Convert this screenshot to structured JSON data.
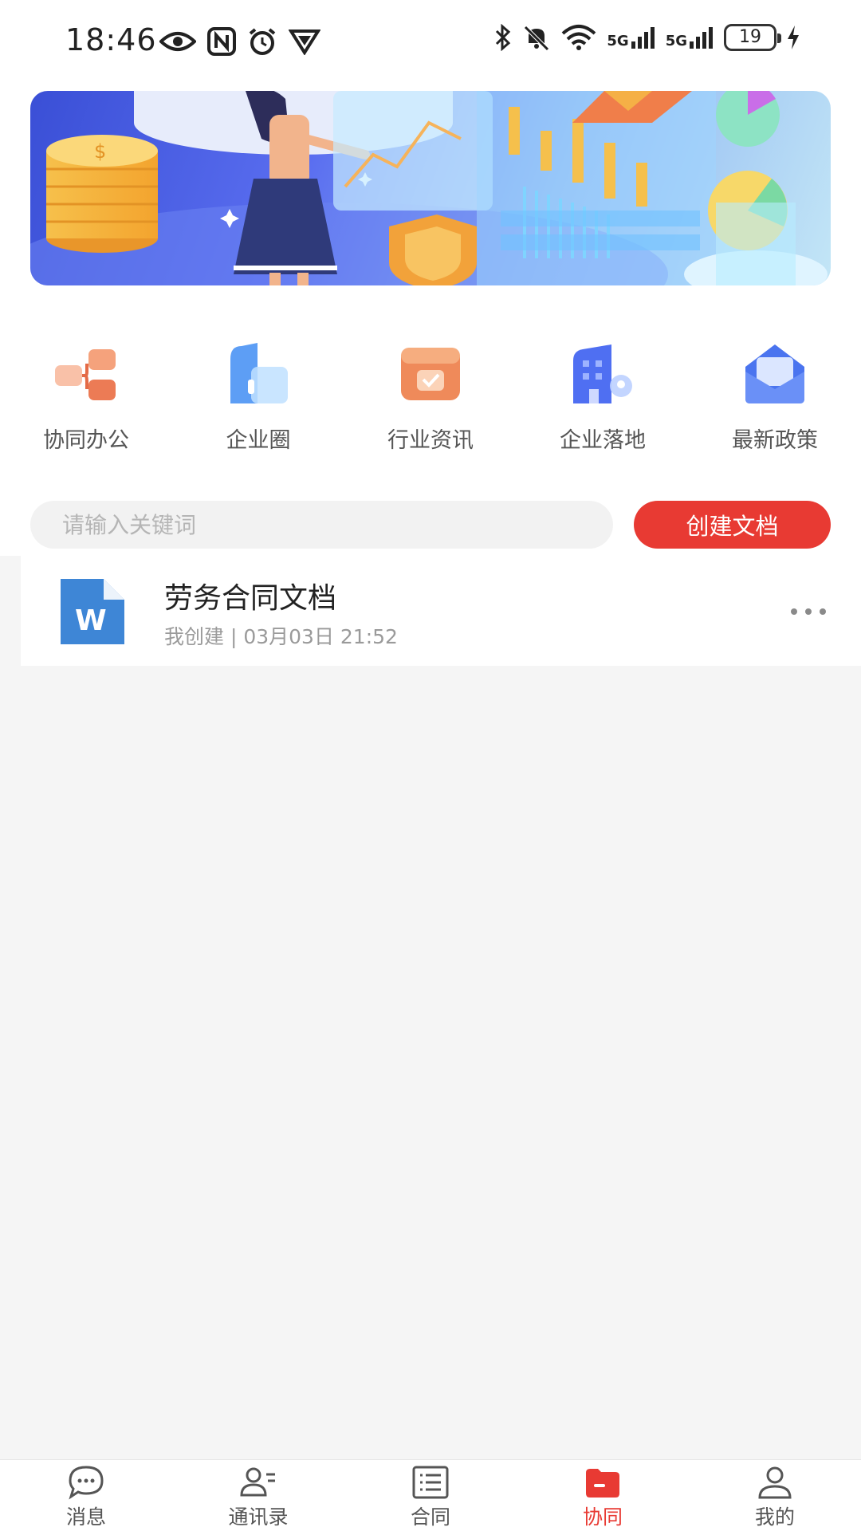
{
  "status_bar": {
    "time": "18:46",
    "net1": "5G",
    "net2": "5G",
    "battery": "19"
  },
  "quick_menu": [
    {
      "label": "协同办公",
      "icon": "collaboration-icon"
    },
    {
      "label": "企业圈",
      "icon": "enterprise-circle-icon"
    },
    {
      "label": "行业资讯",
      "icon": "industry-news-icon"
    },
    {
      "label": "企业落地",
      "icon": "enterprise-landing-icon"
    },
    {
      "label": "最新政策",
      "icon": "latest-policy-icon"
    }
  ],
  "search": {
    "placeholder": "请输入关键词"
  },
  "create_button": "创建文档",
  "documents": [
    {
      "title": "劳务合同文档",
      "meta": "我创建 | 03月03日 21:52",
      "icon_letter": "W"
    }
  ],
  "tabs": [
    {
      "label": "消息",
      "icon": "message-icon",
      "active": false
    },
    {
      "label": "通讯录",
      "icon": "contacts-icon",
      "active": false
    },
    {
      "label": "合同",
      "icon": "contract-icon",
      "active": false
    },
    {
      "label": "协同",
      "icon": "collaboration-folder-icon",
      "active": true
    },
    {
      "label": "我的",
      "icon": "profile-icon",
      "active": false
    }
  ],
  "colors": {
    "accent": "#e83a33",
    "background": "#f5f5f5"
  }
}
